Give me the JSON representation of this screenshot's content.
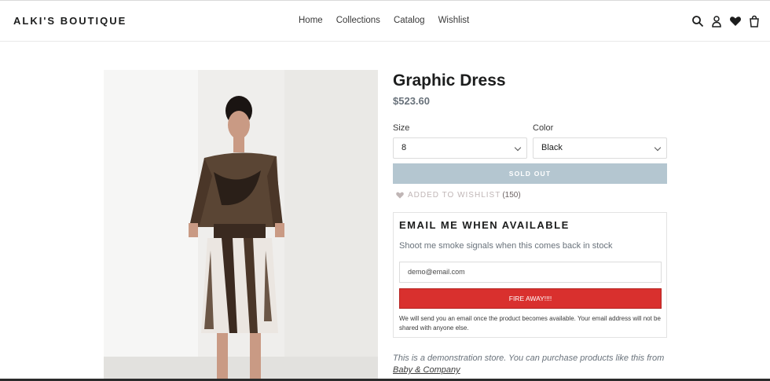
{
  "header": {
    "logo": "ALKI'S BOUTIQUE",
    "nav": [
      "Home",
      "Collections",
      "Catalog",
      "Wishlist"
    ],
    "icons": [
      "search-icon",
      "account-icon",
      "heart-icon",
      "cart-icon"
    ]
  },
  "product": {
    "title": "Graphic Dress",
    "price": "$523.60",
    "size_label": "Size",
    "size_value": "8",
    "color_label": "Color",
    "color_value": "Black",
    "sold_out_label": "SOLD OUT",
    "wishlist_label": "ADDED TO WISHLIST",
    "wishlist_count": "(150)"
  },
  "notify": {
    "title": "EMAIL ME WHEN AVAILABLE",
    "description": "Shoot me smoke signals when this comes back in stock",
    "email_value": "demo@email.com",
    "button_label": "FIRE AWAY!!!!",
    "note": "We will send you an email once the product becomes available. Your email address will not be shared with anyone else."
  },
  "demo": {
    "text": "This is a demonstration store. You can purchase products like this from",
    "link": "Baby & Company"
  },
  "colors": {
    "sold_out_bg": "#b4c6d0",
    "fire_button_bg": "#d9302e",
    "wishlist_heart": "#c0b6b6"
  }
}
